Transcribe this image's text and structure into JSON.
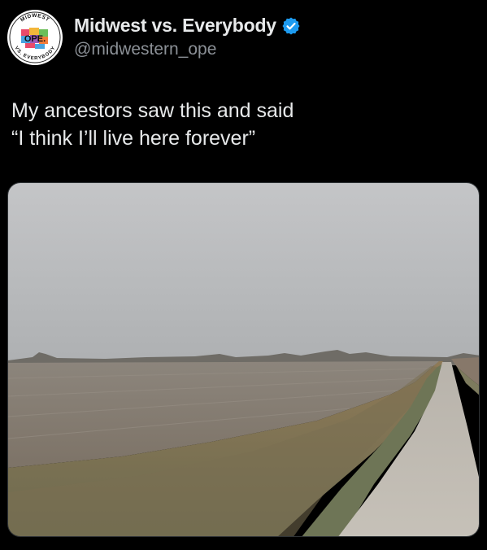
{
  "post": {
    "author": {
      "display_name": "Midwest vs. Everybody",
      "handle": "@midwestern_ope",
      "verified": true,
      "avatar": {
        "ring_top_text": "MIDWEST",
        "ring_bottom_text": "VS. EVERYBODY",
        "center_text": "OPE."
      }
    },
    "text_lines": [
      "My ancestors saw this and said",
      "“I think I’ll live here forever”"
    ],
    "media": {
      "type": "photo"
    }
  },
  "colors": {
    "background": "#000000",
    "text": "#e7e9ea",
    "secondary_text": "#8b9096",
    "verified_badge": "#1d9bf0"
  },
  "icons": [
    "verified-badge-icon"
  ]
}
